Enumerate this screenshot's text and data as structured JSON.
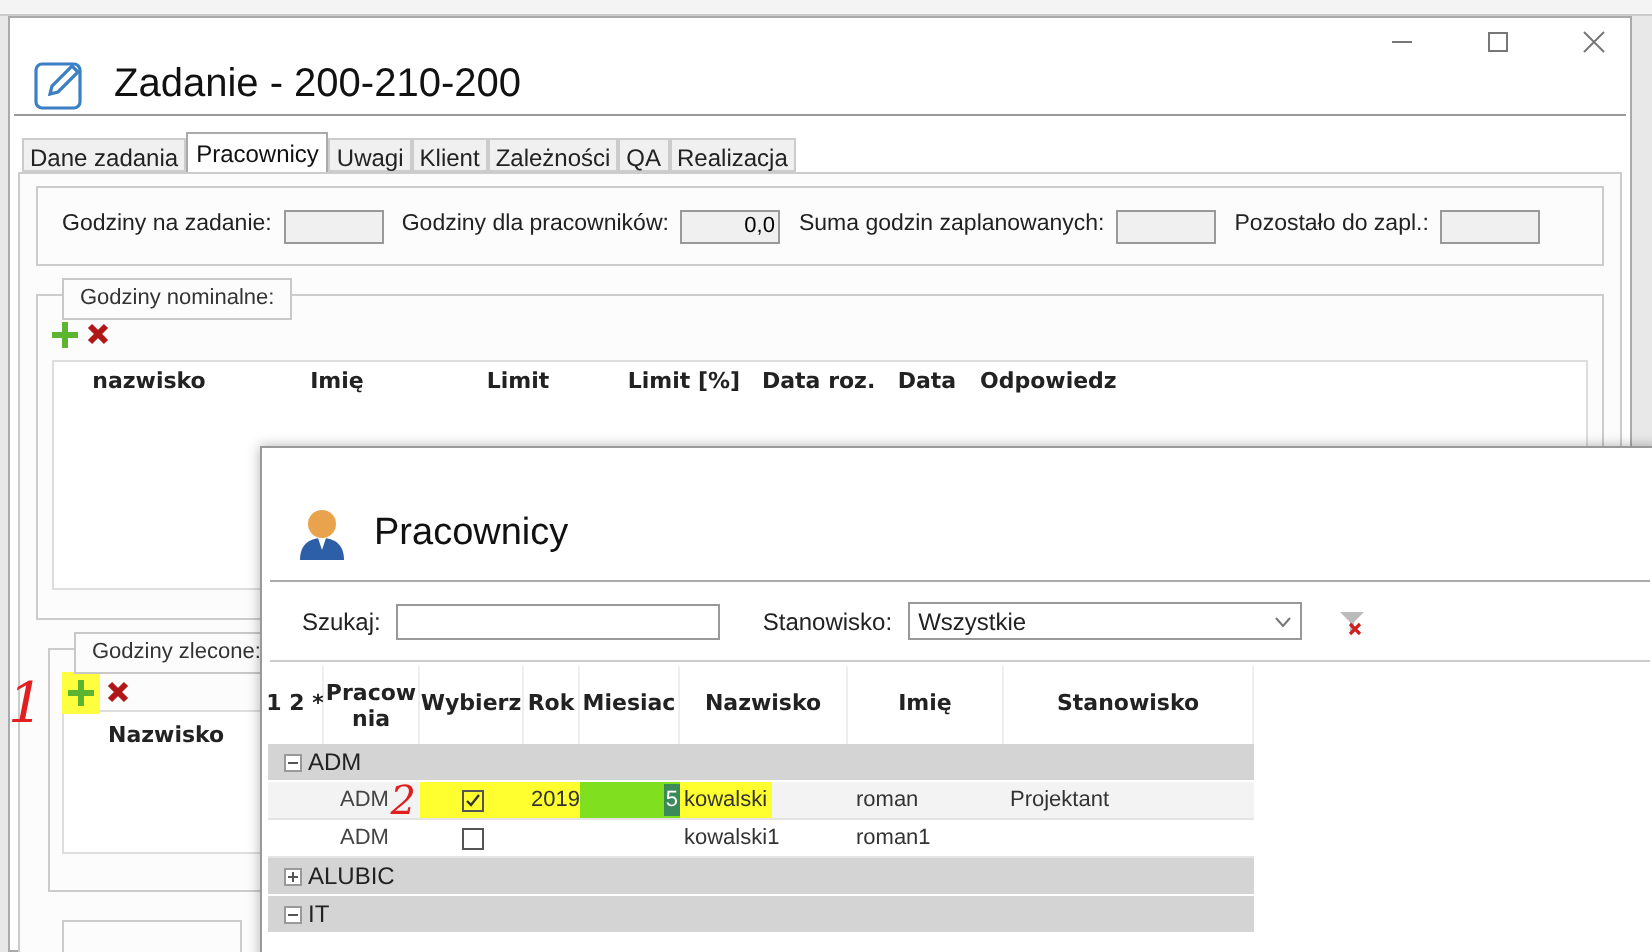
{
  "main_window": {
    "title": "Zadanie - 200-210-200",
    "tabs": [
      {
        "label": "Dane zadania",
        "selected": false
      },
      {
        "label": "Pracownicy",
        "selected": true
      },
      {
        "label": "Uwagi",
        "selected": false
      },
      {
        "label": "Klient",
        "selected": false
      },
      {
        "label": "Zależności",
        "selected": false
      },
      {
        "label": "QA",
        "selected": false
      },
      {
        "label": "Realizacja",
        "selected": false
      }
    ],
    "hours_fields": [
      {
        "label": "Godziny na zadanie:"
      },
      {
        "label": "Godziny dla pracowników:",
        "value": "0,0"
      },
      {
        "label": "Suma godzin zaplanowanych:"
      },
      {
        "label": "Pozostało do zapl.:"
      }
    ],
    "nominal_group": {
      "title": "Godziny nominalne:",
      "columns": [
        "nazwisko",
        "Imię",
        "Limit",
        "Limit [%]",
        "Data roz.",
        "Data",
        "Odpowiedz"
      ]
    },
    "ordered_group": {
      "title": "Godziny zlecone:",
      "add_highlighted": true,
      "columns": [
        "Nazwisko"
      ]
    }
  },
  "dialog": {
    "title": "Pracownicy",
    "search_label": "Szukaj:",
    "position_label": "Stanowisko:",
    "position_value": "Wszystkie",
    "columns": [
      "1 2 *",
      "Pracow nia",
      "Wybierz",
      "Rok",
      "Miesiac",
      "Nazwisko",
      "Imię",
      "Stanowisko"
    ],
    "rows": [
      {
        "kind": "group",
        "label": "ADM",
        "expanded": true
      },
      {
        "kind": "item",
        "pracownia": "ADM",
        "checked": true,
        "rok": "2019",
        "miesiac": "5",
        "nazwisko": "kowalski",
        "imie": "roman",
        "stanowisko": "Projektant",
        "highlighted": true
      },
      {
        "kind": "item",
        "pracownia": "ADM",
        "checked": false,
        "nazwisko": "kowalski1",
        "imie": "roman1",
        "highlighted": false
      },
      {
        "kind": "group",
        "label": "ALUBIC",
        "expanded": false
      },
      {
        "kind": "group",
        "label": "IT",
        "expanded": true
      }
    ]
  },
  "annotations": [
    "1",
    "2"
  ]
}
